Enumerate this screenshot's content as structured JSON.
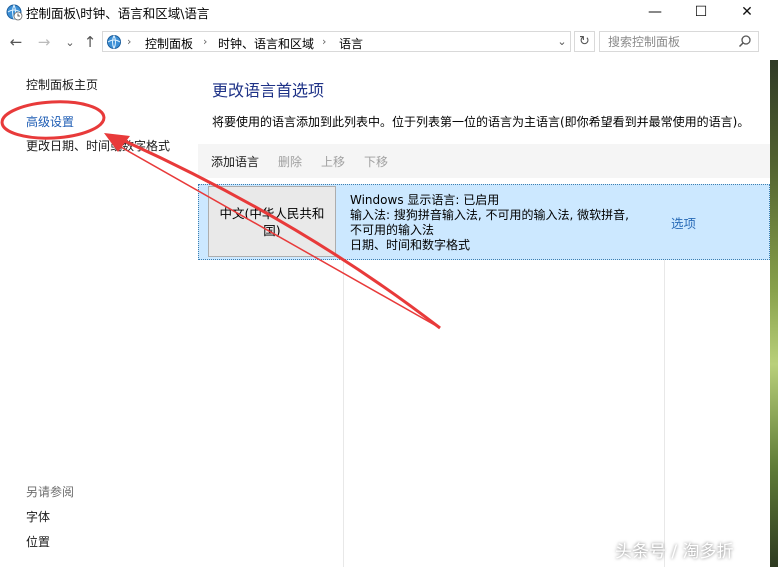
{
  "window": {
    "title": "控制面板\\时钟、语言和区域\\语言",
    "minimize_glyph": "—",
    "maximize_glyph": "☐",
    "close_glyph": "✕"
  },
  "nav": {
    "back_glyph": "←",
    "forward_glyph": "→",
    "recent_glyph": "⌄",
    "up_glyph": "↑"
  },
  "address": {
    "breadcrumbs": [
      "控制面板",
      "时钟、语言和区域",
      "语言"
    ],
    "separator": "›",
    "dropdown_glyph": "⌄",
    "refresh_glyph": "↻"
  },
  "search": {
    "placeholder": "搜索控制面板"
  },
  "sidebar": {
    "home": "控制面板主页",
    "advanced": "高级设置",
    "date_time": "更改日期、时间或数字格式",
    "see_also": "另请参阅",
    "fonts": "字体",
    "location": "位置"
  },
  "main": {
    "title": "更改语言首选项",
    "description": "将要使用的语言添加到此列表中。位于列表第一位的语言为主语言(即你希望看到并最常使用的语言)。",
    "toolbar": {
      "add": "添加语言",
      "remove": "删除",
      "move_up": "上移",
      "move_down": "下移"
    },
    "languages": [
      {
        "name": "中文(中华人民共和国)",
        "details": [
          "Windows 显示语言: 已启用",
          "输入法: 搜狗拼音输入法, 不可用的输入法, 微软拼音,",
          "不可用的输入法",
          "日期、时间和数字格式"
        ],
        "options_label": "选项"
      }
    ]
  },
  "watermark": "头条号 / 淘多折",
  "colors": {
    "link": "#1e5db4",
    "title": "#1e3287",
    "selected_row": "#cce8ff",
    "annotation": "#e83a3a"
  }
}
